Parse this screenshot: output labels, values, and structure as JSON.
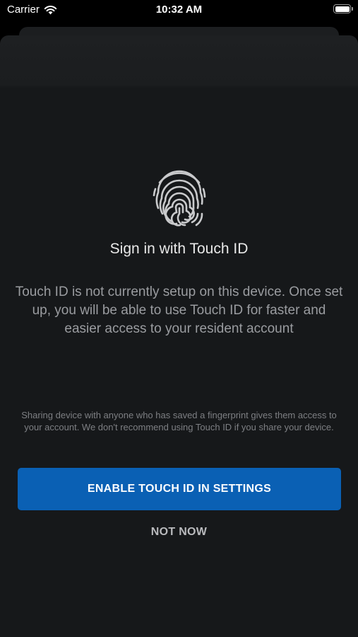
{
  "status_bar": {
    "carrier": "Carrier",
    "time": "10:32 AM"
  },
  "touch_id": {
    "title": "Sign in with Touch ID",
    "description": "Touch ID is not currently setup on this device. Once set up, you will be able to use Touch ID for faster and easier access to your resident account",
    "warning": "Sharing device with anyone who has saved a fingerprint gives them access to your account. We don't recommend using Touch ID if you share your device.",
    "enable_button": "ENABLE TOUCH ID IN SETTINGS",
    "not_now_button": "NOT NOW"
  },
  "icons": {
    "main": "fingerprint-icon",
    "signal": "wifi-icon",
    "power": "battery-icon"
  },
  "colors": {
    "primary_button": "#0a60b4",
    "sheet_background": "#16181a"
  }
}
